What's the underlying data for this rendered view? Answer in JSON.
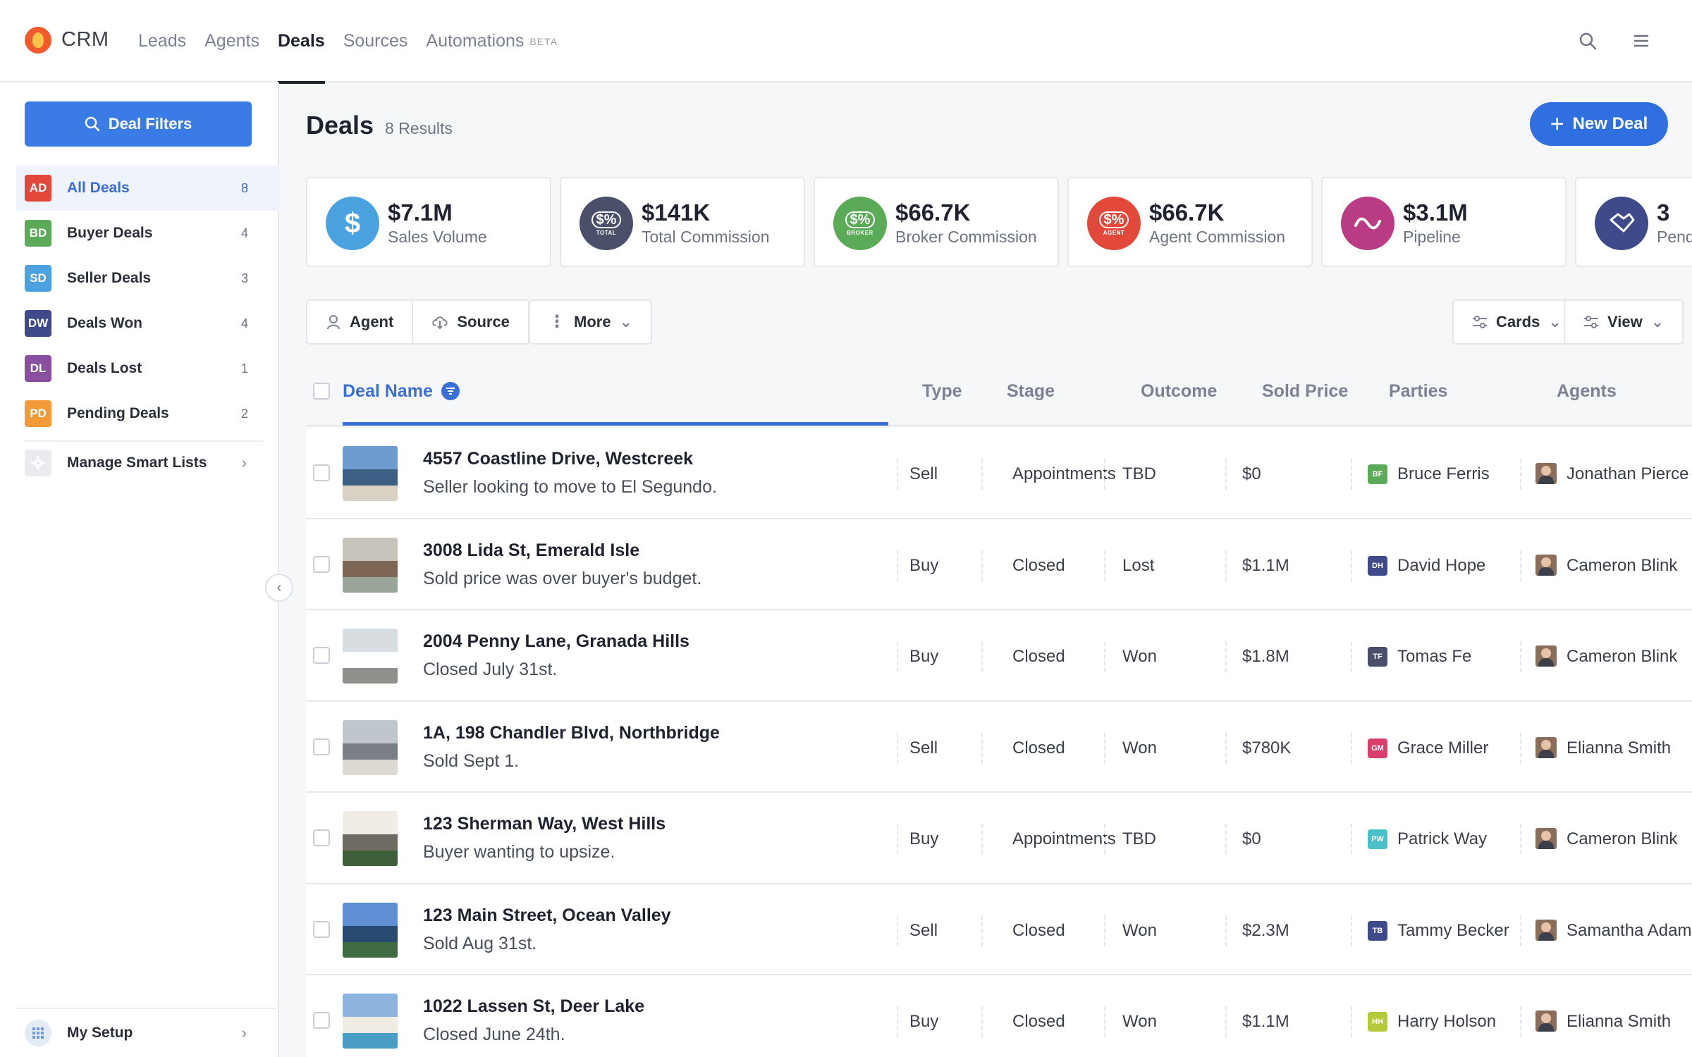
{
  "app": {
    "brand": "CRM",
    "nav": [
      {
        "label": "Leads"
      },
      {
        "label": "Agents"
      },
      {
        "label": "Deals"
      },
      {
        "label": "Sources"
      },
      {
        "label": "Automations",
        "tag": "BETA"
      }
    ],
    "icons": {
      "search": "search-icon",
      "menu": "hamburger-icon"
    }
  },
  "sidebar": {
    "filters_label": "Deal Filters",
    "items": [
      {
        "abbr": "AD",
        "label": "All Deals",
        "count": "8",
        "color": "#e2493b"
      },
      {
        "abbr": "BD",
        "label": "Buyer Deals",
        "count": "4",
        "color": "#5aaa58"
      },
      {
        "abbr": "SD",
        "label": "Seller Deals",
        "count": "3",
        "color": "#4aa3df"
      },
      {
        "abbr": "DW",
        "label": "Deals Won",
        "count": "4",
        "color": "#3f4a8a"
      },
      {
        "abbr": "DL",
        "label": "Deals Lost",
        "count": "1",
        "color": "#8a4fa0"
      },
      {
        "abbr": "PD",
        "label": "Pending Deals",
        "count": "2",
        "color": "#f29a38"
      }
    ],
    "manage_label": "Manage Smart Lists",
    "setup_label": "My Setup"
  },
  "main": {
    "title": "Deals",
    "results": "8 Results",
    "new_deal_label": "New Deal",
    "stats": [
      {
        "value": "$7.1M",
        "label": "Sales Volume",
        "color": "#4aa3df",
        "icon": "dollar-icon",
        "tag": ""
      },
      {
        "value": "$141K",
        "label": "Total Commission",
        "color": "#4a4f6a",
        "icon": "commission-total-icon",
        "tag": "TOTAL"
      },
      {
        "value": "$66.7K",
        "label": "Broker Commission",
        "color": "#5aaa58",
        "icon": "commission-broker-icon",
        "tag": "BROKER"
      },
      {
        "value": "$66.7K",
        "label": "Agent Commission",
        "color": "#e2493b",
        "icon": "commission-agent-icon",
        "tag": "AGENT"
      },
      {
        "value": "$3.1M",
        "label": "Pipeline",
        "color": "#b93b83",
        "icon": "pipeline-icon",
        "tag": ""
      },
      {
        "value": "3",
        "label": "Pending",
        "color": "#3f4a8a",
        "icon": "handshake-icon",
        "tag": ""
      }
    ],
    "toolbar": {
      "agent_label": "Agent",
      "source_label": "Source",
      "more_label": "More",
      "cards_label": "Cards",
      "view_label": "View"
    },
    "columns": {
      "deal_name": "Deal Name",
      "type": "Type",
      "stage": "Stage",
      "outcome": "Outcome",
      "sold_price": "Sold Price",
      "parties": "Parties",
      "agents": "Agents"
    },
    "rows": [
      {
        "name": "4557 Coastline Drive, Westcreek",
        "desc": "Seller looking to move to El Segundo.",
        "type": "Sell",
        "stage": "Appointments",
        "outcome": "TBD",
        "price": "$0",
        "party_abbr": "BF",
        "party": "Bruce Ferris",
        "party_color": "#5aaa58",
        "agent": "Jonathan Pierce",
        "thumb": [
          "#6e9ccf",
          "#3c5f83",
          "#d9d2c4"
        ]
      },
      {
        "name": "3008 Lida St, Emerald Isle",
        "desc": "Sold price was over buyer's budget.",
        "type": "Buy",
        "stage": "Closed",
        "outcome": "Lost",
        "price": "$1.1M",
        "party_abbr": "DH",
        "party": "David Hope",
        "party_color": "#3f4a8a",
        "agent": "Cameron Blink",
        "thumb": [
          "#c9c4bb",
          "#7d6654",
          "#9aa59a"
        ]
      },
      {
        "name": "2004 Penny Lane, Granada Hills",
        "desc": "Closed July 31st.",
        "type": "Buy",
        "stage": "Closed",
        "outcome": "Won",
        "price": "$1.8M",
        "party_abbr": "TF",
        "party": "Tomas Fe",
        "party_color": "#4a4f6a",
        "agent": "Cameron Blink",
        "thumb": [
          "#d8dde2",
          "#ffffff",
          "#8f8f8c"
        ]
      },
      {
        "name": "1A, 198 Chandler Blvd, Northbridge",
        "desc": "Sold Sept 1.",
        "type": "Sell",
        "stage": "Closed",
        "outcome": "Won",
        "price": "$780K",
        "party_abbr": "GM",
        "party": "Grace Miller",
        "party_color": "#d83f6a",
        "agent": "Elianna Smith",
        "thumb": [
          "#bfc6cc",
          "#7a7f86",
          "#dcd8d2"
        ]
      },
      {
        "name": "123 Sherman Way, West Hills",
        "desc": "Buyer wanting to upsize.",
        "type": "Buy",
        "stage": "Appointments",
        "outcome": "TBD",
        "price": "$0",
        "party_abbr": "PW",
        "party": "Patrick Way",
        "party_color": "#4ac0c8",
        "agent": "Cameron Blink",
        "thumb": [
          "#f1ede6",
          "#6f6a62",
          "#3f5e3a"
        ]
      },
      {
        "name": "123 Main Street, Ocean Valley",
        "desc": "Sold Aug 31st.",
        "type": "Sell",
        "stage": "Closed",
        "outcome": "Won",
        "price": "$2.3M",
        "party_abbr": "TB",
        "party": "Tammy Becker",
        "party_color": "#3f4a8a",
        "agent": "Samantha Adam",
        "thumb": [
          "#5f8fd2",
          "#294a6f",
          "#3f6a42"
        ]
      },
      {
        "name": "1022 Lassen St, Deer Lake",
        "desc": "Closed June 24th.",
        "type": "Buy",
        "stage": "Closed",
        "outcome": "Won",
        "price": "$1.1M",
        "party_abbr": "HH",
        "party": "Harry Holson",
        "party_color": "#b6c93a",
        "agent": "Elianna Smith",
        "thumb": [
          "#8cb4de",
          "#f0ece4",
          "#4a9ec5"
        ]
      }
    ]
  }
}
